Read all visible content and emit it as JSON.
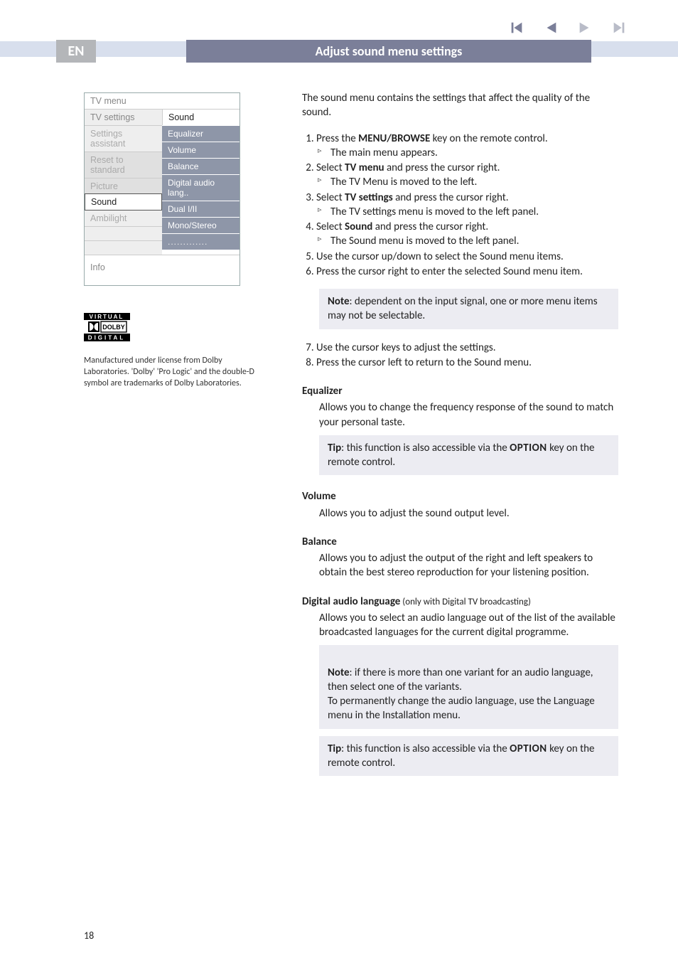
{
  "header": {
    "lang_tag": "EN",
    "title": "Adjust sound menu settings"
  },
  "nav": {
    "first": "skip-back-icon",
    "prev": "play-left-icon",
    "next": "play-right-icon",
    "last": "skip-forward-icon"
  },
  "menu": {
    "title": "TV menu",
    "top_right": "Sound",
    "left_items": [
      "TV settings",
      "Settings assistant",
      "Reset to standard",
      "Picture",
      "Sound",
      "Ambilight"
    ],
    "right_items": [
      "Equalizer",
      "Volume",
      "Balance",
      "Digital audio lang..",
      "Dual I/II",
      "Mono/Stereo",
      "............."
    ],
    "info": "Info"
  },
  "dolby_caption": "Manufactured under license from Dolby Laboratories. 'Dolby' 'Pro Logic' and the double-D symbol are trademarks of Dolby Laboratories.",
  "intro": "The sound menu contains the settings that affect the quality of the sound.",
  "steps": {
    "s1": "Press the ",
    "s1_bold": "MENU/BROWSE",
    "s1_tail": " key on the remote control.",
    "s1_sub": "The main menu appears.",
    "s2": "Select ",
    "s2_bold": "TV menu",
    "s2_tail": " and press the cursor right.",
    "s2_sub": "The TV Menu is moved to the left.",
    "s3": "Select ",
    "s3_bold": "TV settings",
    "s3_tail": " and press the cursor right.",
    "s3_sub": "The TV settings menu is moved to the left panel.",
    "s4": "Select ",
    "s4_bold": "Sound",
    "s4_tail": " and press the cursor right.",
    "s4_sub": "The Sound menu is moved to the left panel.",
    "s5": "Use the cursor up/down to select the Sound menu items.",
    "s6": "Press the cursor right to enter the selected Sound menu item."
  },
  "note1_bold": "Note",
  "note1": ": dependent on the input signal, one or more menu items may not be selectable.",
  "s7": "Use the cursor keys to adjust the settings.",
  "s8": "Press the cursor left to return to the Sound menu.",
  "eq": {
    "head": "Equalizer",
    "body": "Allows you to change the frequency response of the sound to match your personal taste.",
    "tip_bold": "Tip",
    "tip1": ": this function is also accessible via the ",
    "tip_opt": "OPTION",
    "tip2": " key on the remote control."
  },
  "vol": {
    "head": "Volume",
    "body": "Allows you to adjust the sound output level."
  },
  "bal": {
    "head": "Balance",
    "body": "Allows you to adjust the output of the right and left speakers to obtain the best stereo reproduction for your listening position."
  },
  "dal": {
    "head": "Digital audio language",
    "qual": " (only with Digital TV broadcasting)",
    "body": "Allows you to select an audio language out of the list of the available broadcasted languages for the current digital programme.",
    "note_bold": "Note",
    "note": ": if there is more than one variant for an audio language, then select one of the variants.\nTo permanently change the audio language, use the Language menu in the Installation menu.",
    "tip_bold": "Tip",
    "tip1": ": this function is also accessible via the ",
    "tip_opt": "OPTION",
    "tip2": " key on the remote control."
  },
  "page_number": "18"
}
